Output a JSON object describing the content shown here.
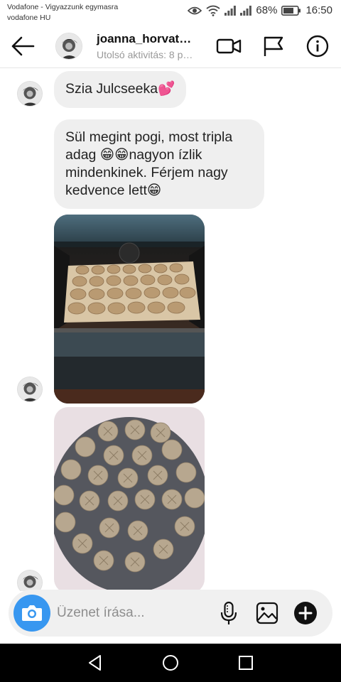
{
  "status_bar": {
    "carrier_line1": "Vodafone - Vigyazzunk egymasra",
    "carrier_line2": "vodafone HU",
    "battery": "68%",
    "time": "16:50"
  },
  "header": {
    "username": "joanna_horvat…",
    "activity": "Utolsó aktivitás: 8 p…",
    "icons": [
      "back-arrow-icon",
      "video-call-icon",
      "flag-icon",
      "info-icon"
    ]
  },
  "messages": [
    {
      "type": "text",
      "text": "Szia Julcseeka💕"
    },
    {
      "type": "text",
      "text": "Sül megint pogi, most tripla adag 😁😁nagyon ízlik mindenkinek. Férjem nagy kedvence lett😁"
    },
    {
      "type": "photo",
      "subject": "pogácsa in oven"
    },
    {
      "type": "photo",
      "subject": "raw pogácsa on baking paper"
    }
  ],
  "composer": {
    "placeholder": "Üzenet írása...",
    "icons": [
      "camera-icon",
      "microphone-icon",
      "gallery-icon",
      "plus-icon"
    ]
  },
  "colors": {
    "accent": "#3897f0",
    "bubble": "#efefef",
    "nav": "#000000"
  }
}
